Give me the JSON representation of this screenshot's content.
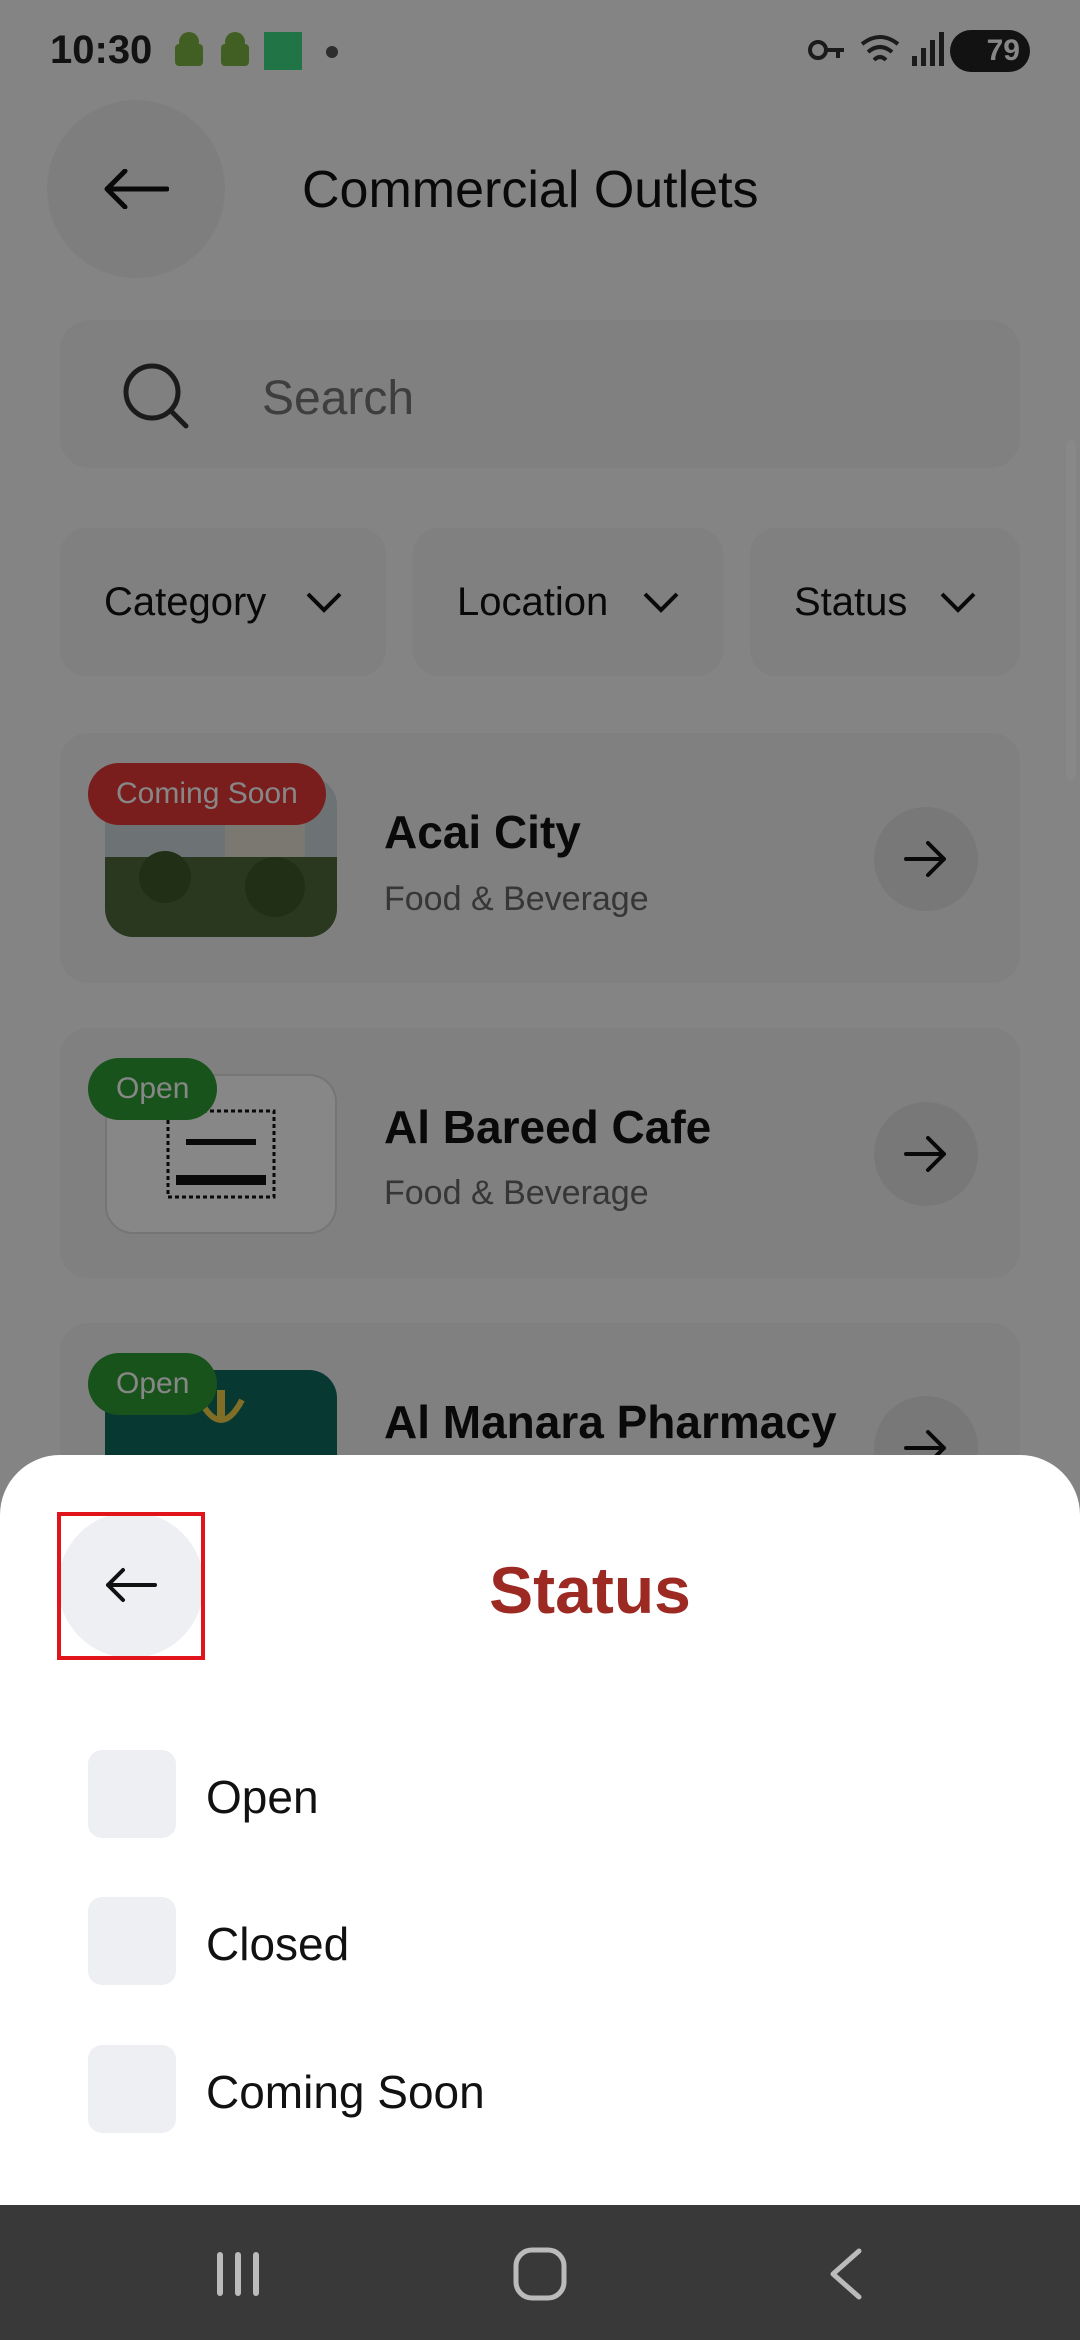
{
  "status_bar": {
    "time": "10:30",
    "battery": "79"
  },
  "header": {
    "title": "Commercial Outlets"
  },
  "search": {
    "placeholder": "Search"
  },
  "filters": {
    "category": "Category",
    "location": "Location",
    "status": "Status"
  },
  "outlets": [
    {
      "name": "Acai City",
      "category": "Food & Beverage",
      "status": "Coming Soon",
      "status_color": "#e53935"
    },
    {
      "name": "Al Bareed Cafe",
      "category": "Food & Beverage",
      "status": "Open",
      "status_color": "#2e9e36"
    },
    {
      "name": "Al Manara Pharmacy",
      "category": "",
      "status": "Open",
      "status_color": "#2e9e36"
    }
  ],
  "sheet": {
    "title": "Status",
    "options": [
      "Open",
      "Closed",
      "Coming Soon"
    ]
  },
  "colors": {
    "accent": "#9c2a22",
    "highlight": "#e1141b"
  }
}
